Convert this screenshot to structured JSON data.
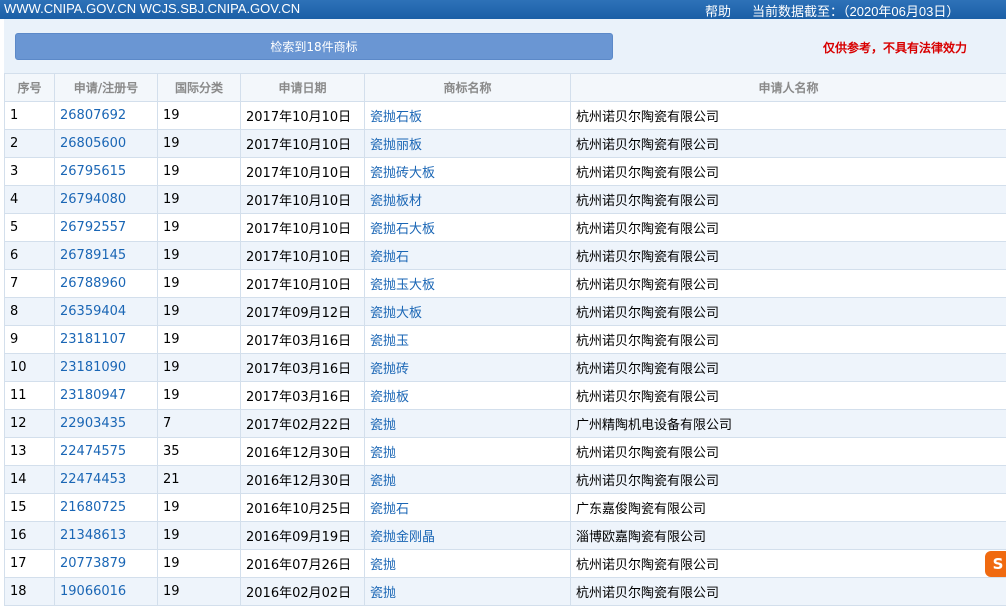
{
  "header": {
    "site": "WWW.CNIPA.GOV.CN WCJS.SBJ.CNIPA.GOV.CN",
    "help": "帮助",
    "data_date": "当前数据截至：（2020年06月03日）"
  },
  "summary": {
    "result_label": "检索到18件商标",
    "disclaimer": "仅供参考，不具有法律效力"
  },
  "table": {
    "columns": [
      "序号",
      "申请/注册号",
      "国际分类",
      "申请日期",
      "商标名称",
      "申请人名称"
    ],
    "rows": [
      {
        "no": "1",
        "reg": "26807692",
        "cls": "19",
        "date": "2017年10月10日",
        "mark": "瓷抛石板",
        "applicant": "杭州诺贝尔陶瓷有限公司"
      },
      {
        "no": "2",
        "reg": "26805600",
        "cls": "19",
        "date": "2017年10月10日",
        "mark": "瓷抛丽板",
        "applicant": "杭州诺贝尔陶瓷有限公司"
      },
      {
        "no": "3",
        "reg": "26795615",
        "cls": "19",
        "date": "2017年10月10日",
        "mark": "瓷抛砖大板",
        "applicant": "杭州诺贝尔陶瓷有限公司"
      },
      {
        "no": "4",
        "reg": "26794080",
        "cls": "19",
        "date": "2017年10月10日",
        "mark": "瓷抛板材",
        "applicant": "杭州诺贝尔陶瓷有限公司"
      },
      {
        "no": "5",
        "reg": "26792557",
        "cls": "19",
        "date": "2017年10月10日",
        "mark": "瓷抛石大板",
        "applicant": "杭州诺贝尔陶瓷有限公司"
      },
      {
        "no": "6",
        "reg": "26789145",
        "cls": "19",
        "date": "2017年10月10日",
        "mark": "瓷抛石",
        "applicant": "杭州诺贝尔陶瓷有限公司"
      },
      {
        "no": "7",
        "reg": "26788960",
        "cls": "19",
        "date": "2017年10月10日",
        "mark": "瓷抛玉大板",
        "applicant": "杭州诺贝尔陶瓷有限公司"
      },
      {
        "no": "8",
        "reg": "26359404",
        "cls": "19",
        "date": "2017年09月12日",
        "mark": "瓷抛大板",
        "applicant": "杭州诺贝尔陶瓷有限公司"
      },
      {
        "no": "9",
        "reg": "23181107",
        "cls": "19",
        "date": "2017年03月16日",
        "mark": "瓷抛玉",
        "applicant": "杭州诺贝尔陶瓷有限公司"
      },
      {
        "no": "10",
        "reg": "23181090",
        "cls": "19",
        "date": "2017年03月16日",
        "mark": "瓷抛砖",
        "applicant": "杭州诺贝尔陶瓷有限公司"
      },
      {
        "no": "11",
        "reg": "23180947",
        "cls": "19",
        "date": "2017年03月16日",
        "mark": "瓷抛板",
        "applicant": "杭州诺贝尔陶瓷有限公司"
      },
      {
        "no": "12",
        "reg": "22903435",
        "cls": "7",
        "date": "2017年02月22日",
        "mark": "瓷抛",
        "applicant": "广州精陶机电设备有限公司"
      },
      {
        "no": "13",
        "reg": "22474575",
        "cls": "35",
        "date": "2016年12月30日",
        "mark": "瓷抛",
        "applicant": "杭州诺贝尔陶瓷有限公司"
      },
      {
        "no": "14",
        "reg": "22474453",
        "cls": "21",
        "date": "2016年12月30日",
        "mark": "瓷抛",
        "applicant": "杭州诺贝尔陶瓷有限公司"
      },
      {
        "no": "15",
        "reg": "21680725",
        "cls": "19",
        "date": "2016年10月25日",
        "mark": "瓷抛石",
        "applicant": "广东嘉俊陶瓷有限公司"
      },
      {
        "no": "16",
        "reg": "21348613",
        "cls": "19",
        "date": "2016年09月19日",
        "mark": "瓷抛金刚晶",
        "applicant": "淄博欧嘉陶瓷有限公司"
      },
      {
        "no": "17",
        "reg": "20773879",
        "cls": "19",
        "date": "2016年07月26日",
        "mark": "瓷抛",
        "applicant": "杭州诺贝尔陶瓷有限公司"
      },
      {
        "no": "18",
        "reg": "19066016",
        "cls": "19",
        "date": "2016年02月02日",
        "mark": "瓷抛",
        "applicant": "杭州诺贝尔陶瓷有限公司"
      }
    ]
  },
  "floating": {
    "icon_glyph": "S",
    "icon_name": "sogou-input-icon"
  }
}
